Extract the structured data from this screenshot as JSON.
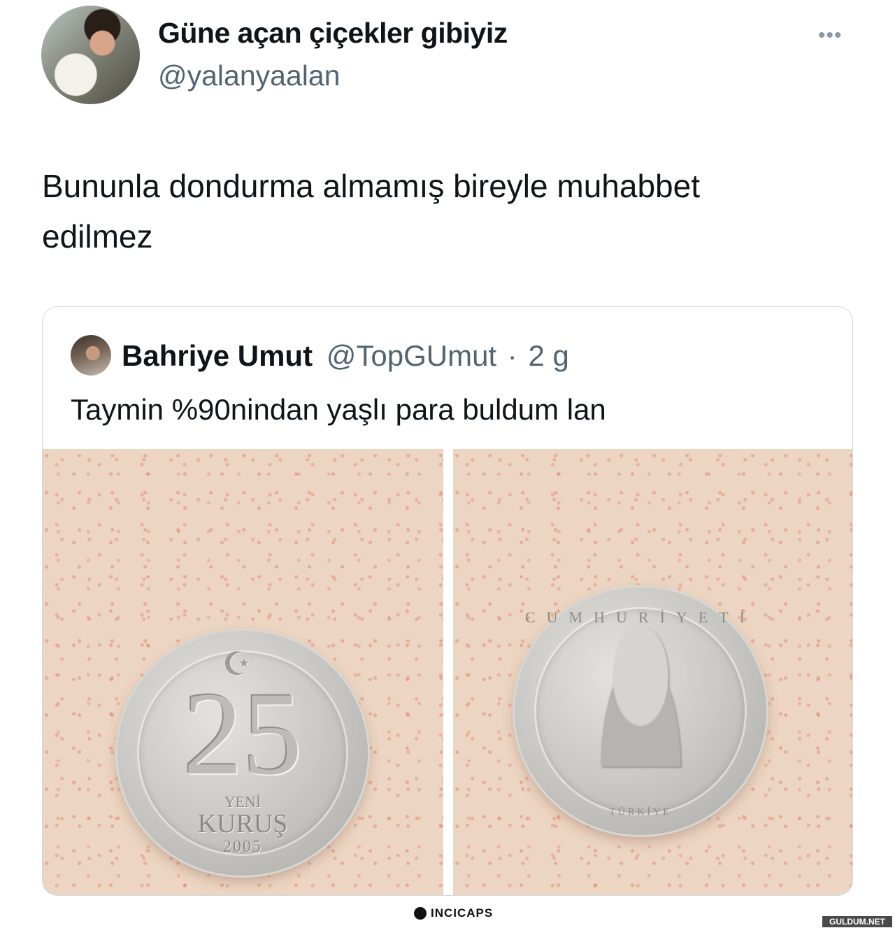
{
  "tweet": {
    "display_name": "Güne açan çiçekler gibiyiz",
    "handle": "@yalanyaalan",
    "more_icon": "more-horizontal-icon",
    "text_line1": "Bununla dondurma almamış bireyle muhabbet",
    "text_line2": "edilmez"
  },
  "quoted_tweet": {
    "display_name": "Bahriye Umut",
    "handle": "@TopGUmut",
    "separator": "·",
    "time": "2 g",
    "text": "Taymin %90nindan yaşlı para buldum lan"
  },
  "coin_left": {
    "symbol": "☪",
    "number": "25",
    "yeni": "YENİ",
    "kurus": "KURUŞ",
    "year": "2005"
  },
  "coin_right": {
    "ring_top": "CUMHURİYETİ",
    "ring_bottom": "TÜRKİYE"
  },
  "watermarks": {
    "incicaps": "INCICAPS",
    "gulum": "GULDUM.NET"
  }
}
